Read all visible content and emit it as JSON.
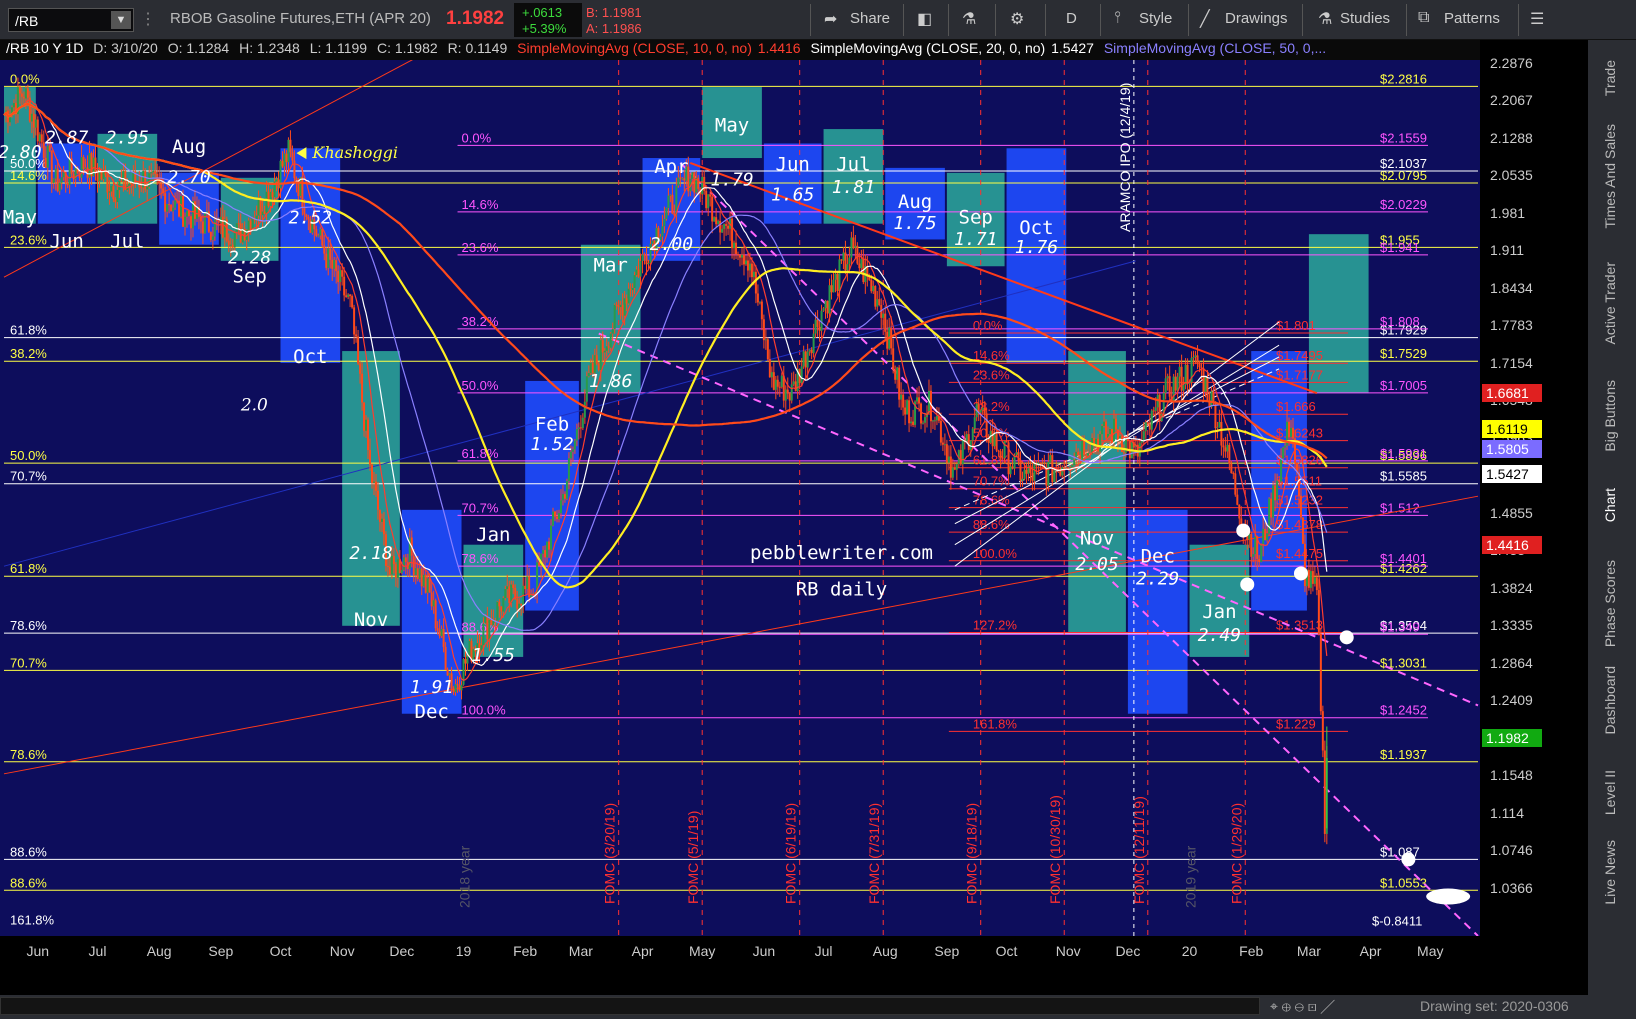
{
  "toolbar": {
    "symbol": "/RB",
    "instrument": "RBOB Gasoline Futures,ETH (APR 20)",
    "last": "1.1982",
    "change": "+.0613",
    "change_pct": "+5.39%",
    "bid": "B: 1.1981",
    "ask": "A: 1.1986",
    "share": "Share",
    "period": "D",
    "style": "Style",
    "drawings": "Drawings",
    "studies": "Studies",
    "patterns": "Patterns"
  },
  "info": {
    "series": "/RB 10 Y 1D",
    "date": "D: 3/10/20",
    "open": "O: 1.1284",
    "high": "H: 1.2348",
    "low": "L: 1.1199",
    "close": "C: 1.1982",
    "range": "R: 0.1149",
    "sma10": "SimpleMovingAvg (CLOSE, 10, 0, no)",
    "sma10_val": "1.4416",
    "sma20": "SimpleMovingAvg (CLOSE, 20, 0, no)",
    "sma20_val": "1.5427",
    "sma50": "SimpleMovingAvg (CLOSE, 50, 0,..."
  },
  "right_tabs": [
    "Trade",
    "Times And Sales",
    "Active Trader",
    "Big Buttons",
    "Chart",
    "Phase Scores",
    "Dashboard",
    "Level II",
    "Live News"
  ],
  "drawing_set": "Drawing set: 2020-0306",
  "colors": {
    "bg": "#0d0d5c",
    "candle": "#ff4a1a",
    "sma10": "#ff3d2e",
    "sma20": "#ffffff",
    "sma50": "#8a80ff",
    "sma200": "#ff3a1a",
    "fib_yellow": "#ffff44",
    "fib_magenta": "#ff55ff",
    "fomc": "#ff3030",
    "teal": "#2aa198",
    "blue": "#1f4cff"
  },
  "chart_data": {
    "type": "candlestick",
    "title": "pebblewriter.com RB daily",
    "x_range": [
      "2018-05-15",
      "2020-05-25"
    ],
    "y_range": [
      1.01,
      2.34
    ],
    "x_ticks": [
      {
        "d": "2018-06-01",
        "label": "Jun"
      },
      {
        "d": "2018-07-01",
        "label": "Jul"
      },
      {
        "d": "2018-08-01",
        "label": "Aug"
      },
      {
        "d": "2018-09-01",
        "label": "Sep"
      },
      {
        "d": "2018-10-01",
        "label": "Oct"
      },
      {
        "d": "2018-11-01",
        "label": "Nov"
      },
      {
        "d": "2018-12-01",
        "label": "Dec"
      },
      {
        "d": "2019-01-01",
        "label": "19"
      },
      {
        "d": "2019-02-01",
        "label": "Feb"
      },
      {
        "d": "2019-03-01",
        "label": "Mar"
      },
      {
        "d": "2019-04-01",
        "label": "Apr"
      },
      {
        "d": "2019-05-01",
        "label": "May"
      },
      {
        "d": "2019-06-01",
        "label": "Jun"
      },
      {
        "d": "2019-07-01",
        "label": "Jul"
      },
      {
        "d": "2019-08-01",
        "label": "Aug"
      },
      {
        "d": "2019-09-01",
        "label": "Sep"
      },
      {
        "d": "2019-10-01",
        "label": "Oct"
      },
      {
        "d": "2019-11-01",
        "label": "Nov"
      },
      {
        "d": "2019-12-01",
        "label": "Dec"
      },
      {
        "d": "2020-01-01",
        "label": "20"
      },
      {
        "d": "2020-02-01",
        "label": "Feb"
      },
      {
        "d": "2020-03-01",
        "label": "Mar"
      },
      {
        "d": "2020-04-01",
        "label": "Apr"
      },
      {
        "d": "2020-05-01",
        "label": "May"
      }
    ],
    "y_ticks": [
      "2.2876",
      "2.2067",
      "2.1288",
      "2.0535",
      "1.981",
      "1.911",
      "1.8434",
      "1.7783",
      "1.7154",
      "1.6548",
      "1.5963",
      "1.5399",
      "1.4855",
      "1.433",
      "1.3824",
      "1.3335",
      "1.2864",
      "1.2409",
      "1.1971",
      "1.1548",
      "1.114",
      "1.0746",
      "1.0366"
    ],
    "price_tags": [
      {
        "v": 1.6681,
        "label": "1.6681",
        "bg": "#e02020",
        "fg": "#ffffff"
      },
      {
        "v": 1.6119,
        "label": "1.6119",
        "bg": "#ffff00",
        "fg": "#000000"
      },
      {
        "v": 1.5805,
        "label": "1.5805",
        "bg": "#7b6cff",
        "fg": "#ffffff"
      },
      {
        "v": 1.5427,
        "label": "1.5427",
        "bg": "#ffffff",
        "fg": "#000000"
      },
      {
        "v": 1.4416,
        "label": "1.4416",
        "bg": "#e02020",
        "fg": "#ffffff"
      },
      {
        "v": 1.1982,
        "label": "1.1982",
        "bg": "#11aa11",
        "fg": "#ffffff"
      }
    ],
    "ohlc_anchors": [
      [
        "2018-05-15",
        2.22
      ],
      [
        "2018-05-25",
        2.27
      ],
      [
        "2018-06-10",
        2.08
      ],
      [
        "2018-06-25",
        2.12
      ],
      [
        "2018-07-10",
        2.07
      ],
      [
        "2018-07-25",
        2.09
      ],
      [
        "2018-08-10",
        2.03
      ],
      [
        "2018-08-25",
        2.0
      ],
      [
        "2018-09-10",
        1.98
      ],
      [
        "2018-09-25",
        2.06
      ],
      [
        "2018-10-05",
        2.14
      ],
      [
        "2018-10-15",
        2.02
      ],
      [
        "2018-10-25",
        1.93
      ],
      [
        "2018-11-05",
        1.85
      ],
      [
        "2018-11-15",
        1.58
      ],
      [
        "2018-11-25",
        1.43
      ],
      [
        "2018-12-05",
        1.46
      ],
      [
        "2018-12-15",
        1.4
      ],
      [
        "2018-12-27",
        1.28
      ],
      [
        "2019-01-05",
        1.33
      ],
      [
        "2019-01-20",
        1.39
      ],
      [
        "2019-02-05",
        1.41
      ],
      [
        "2019-02-20",
        1.54
      ],
      [
        "2019-03-05",
        1.72
      ],
      [
        "2019-03-25",
        1.88
      ],
      [
        "2019-04-10",
        2.0
      ],
      [
        "2019-04-25",
        2.1
      ],
      [
        "2019-05-10",
        2.01
      ],
      [
        "2019-05-25",
        1.93
      ],
      [
        "2019-06-05",
        1.72
      ],
      [
        "2019-06-15",
        1.7
      ],
      [
        "2019-06-30",
        1.84
      ],
      [
        "2019-07-15",
        1.95
      ],
      [
        "2019-07-30",
        1.85
      ],
      [
        "2019-08-10",
        1.67
      ],
      [
        "2019-08-25",
        1.68
      ],
      [
        "2019-09-05",
        1.57
      ],
      [
        "2019-09-16",
        1.67
      ],
      [
        "2019-09-25",
        1.62
      ],
      [
        "2019-10-10",
        1.57
      ],
      [
        "2019-10-25",
        1.58
      ],
      [
        "2019-11-10",
        1.62
      ],
      [
        "2019-11-25",
        1.64
      ],
      [
        "2019-12-05",
        1.6
      ],
      [
        "2019-12-20",
        1.7
      ],
      [
        "2020-01-05",
        1.75
      ],
      [
        "2020-01-15",
        1.66
      ],
      [
        "2020-01-28",
        1.5
      ],
      [
        "2020-02-05",
        1.45
      ],
      [
        "2020-02-15",
        1.58
      ],
      [
        "2020-02-21",
        1.66
      ],
      [
        "2020-02-28",
        1.43
      ],
      [
        "2020-03-05",
        1.4
      ],
      [
        "2020-03-09",
        1.13
      ],
      [
        "2020-03-10",
        1.198
      ]
    ],
    "last_bar": {
      "date": "2020-03-10",
      "open": 1.1284,
      "high": 1.2348,
      "low": 1.1199,
      "close": 1.1982
    },
    "moving_averages": [
      {
        "name": "SimpleMovingAvg (CLOSE, 10, 0, no)",
        "color": "#ff3d2e",
        "window": 10
      },
      {
        "name": "SimpleMovingAvg (CLOSE, 20, 0, no)",
        "color": "#ffffff",
        "window": 20
      },
      {
        "name": "SimpleMovingAvg (CLOSE, 50, 0,...",
        "color": "#8a80ff",
        "window": 50
      },
      {
        "name": "",
        "color": "#ffee22",
        "window": 100
      },
      {
        "name": "",
        "color": "#ff4a1a",
        "window": 200
      }
    ],
    "month_boxes": [
      {
        "s": "2018-05-15",
        "e": "2018-05-31",
        "lo": 2.0,
        "hi": 2.28,
        "c": "teal",
        "label": "May",
        "price": "2.80",
        "lab_y": 2.0,
        "pr_y": 2.13
      },
      {
        "s": "2018-06-01",
        "e": "2018-06-30",
        "lo": 2.0,
        "hi": 2.16,
        "c": "blue",
        "label": "Jun",
        "price": "2.87",
        "lab_y": 1.955,
        "pr_y": 2.16
      },
      {
        "s": "2018-07-01",
        "e": "2018-07-31",
        "lo": 2.0,
        "hi": 2.18,
        "c": "teal",
        "label": "Jul",
        "price": "2.95",
        "lab_y": 1.955,
        "pr_y": 2.16
      },
      {
        "s": "2018-08-01",
        "e": "2018-08-31",
        "lo": 1.96,
        "hi": 2.1,
        "c": "blue",
        "label": "Aug",
        "price": "2.70",
        "lab_y": 2.14,
        "pr_y": 2.08
      },
      {
        "s": "2018-09-01",
        "e": "2018-09-30",
        "lo": 1.93,
        "hi": 2.09,
        "c": "teal",
        "label": "Sep",
        "price": "2.28",
        "lab_y": 1.89,
        "pr_y": 1.925
      },
      {
        "s": "2018-10-01",
        "e": "2018-10-31",
        "lo": 1.75,
        "hi": 2.15,
        "c": "blue",
        "label": "Oct",
        "price": "2.52",
        "lab_y": 1.75,
        "pr_y": 2.0
      },
      {
        "s": "2018-11-01",
        "e": "2018-11-30",
        "lo": 1.36,
        "hi": 1.77,
        "c": "teal",
        "label": "Nov",
        "price": "2.18",
        "lab_y": 1.36,
        "pr_y": 1.45
      },
      {
        "s": "2018-12-01",
        "e": "2018-12-31",
        "lo": 1.25,
        "hi": 1.52,
        "c": "blue",
        "label": "Dec",
        "price": "1.91",
        "lab_y": 1.245,
        "pr_y": 1.275
      },
      {
        "s": "2019-01-01",
        "e": "2019-01-31",
        "lo": 1.32,
        "hi": 1.47,
        "c": "teal",
        "label": "Jan",
        "price": "1.55",
        "lab_y": 1.475,
        "pr_y": 1.315
      },
      {
        "s": "2019-02-01",
        "e": "2019-02-28",
        "lo": 1.38,
        "hi": 1.72,
        "c": "blue",
        "label": "Feb",
        "price": "1.52",
        "lab_y": 1.64,
        "pr_y": 1.61
      },
      {
        "s": "2019-03-01",
        "e": "2019-03-31",
        "lo": 1.7,
        "hi": 1.96,
        "c": "teal",
        "label": "Mar",
        "price": "1.86",
        "lab_y": 1.91,
        "pr_y": 1.71
      },
      {
        "s": "2019-04-01",
        "e": "2019-04-30",
        "lo": 1.93,
        "hi": 2.13,
        "c": "blue",
        "label": "Apr",
        "price": "2.00",
        "lab_y": 2.1,
        "pr_y": 1.95
      },
      {
        "s": "2019-05-01",
        "e": "2019-05-31",
        "lo": 2.13,
        "hi": 2.28,
        "c": "teal",
        "label": "May",
        "price": "1.79",
        "lab_y": 2.185,
        "pr_y": 2.075
      },
      {
        "s": "2019-06-01",
        "e": "2019-06-30",
        "lo": 2.0,
        "hi": 2.16,
        "c": "blue",
        "label": "Jun",
        "price": "1.65",
        "lab_y": 2.105,
        "pr_y": 2.045
      },
      {
        "s": "2019-07-01",
        "e": "2019-07-31",
        "lo": 2.0,
        "hi": 2.19,
        "c": "teal",
        "label": "Jul",
        "price": "1.81",
        "lab_y": 2.105,
        "pr_y": 2.06
      },
      {
        "s": "2019-08-01",
        "e": "2019-08-31",
        "lo": 1.97,
        "hi": 2.11,
        "c": "blue",
        "label": "Aug",
        "price": "1.75",
        "lab_y": 2.03,
        "pr_y": 1.99
      },
      {
        "s": "2019-09-01",
        "e": "2019-09-30",
        "lo": 1.92,
        "hi": 2.1,
        "c": "teal",
        "label": "Sep",
        "price": "1.71",
        "lab_y": 2.0,
        "pr_y": 1.96
      },
      {
        "s": "2019-10-01",
        "e": "2019-10-31",
        "lo": 1.75,
        "hi": 2.15,
        "c": "blue",
        "label": "Oct",
        "price": "1.76",
        "lab_y": 1.98,
        "pr_y": 1.945
      },
      {
        "s": "2019-11-01",
        "e": "2019-11-30",
        "lo": 1.35,
        "hi": 1.77,
        "c": "teal",
        "label": "Nov",
        "price": "2.05",
        "lab_y": 1.47,
        "pr_y": 1.435
      },
      {
        "s": "2019-12-01",
        "e": "2019-12-31",
        "lo": 1.25,
        "hi": 1.52,
        "c": "blue",
        "label": "Dec",
        "price": "2.29",
        "lab_y": 1.445,
        "pr_y": 1.415
      },
      {
        "s": "2020-01-01",
        "e": "2020-01-31",
        "lo": 1.32,
        "hi": 1.47,
        "c": "teal",
        "label": "Jan",
        "price": "2.49",
        "lab_y": 1.37,
        "pr_y": 1.34
      },
      {
        "s": "2020-02-01",
        "e": "2020-02-29",
        "lo": 1.38,
        "hi": 1.77,
        "c": "blue",
        "label": "",
        "price": "",
        "lab_y": 0,
        "pr_y": 0
      },
      {
        "s": "2020-03-01",
        "e": "2020-03-31",
        "lo": 1.7,
        "hi": 1.98,
        "c": "teal",
        "label": "",
        "price": "",
        "lab_y": 0,
        "pr_y": 0
      }
    ],
    "fib_lines_left": [
      {
        "v": 2.2816,
        "label": "0.0%",
        "price": "$2.2816"
      },
      {
        "v": 2.0795,
        "label": "14.6%",
        "price": "$2.0795"
      },
      {
        "v": 2.1037,
        "label": "50.0%",
        "price": "$2.1037",
        "c": "#ffffff"
      },
      {
        "v": 1.955,
        "label": "23.6%",
        "price": "$1.955"
      },
      {
        "v": 1.7929,
        "label": "61.8%",
        "price": "$1.7929",
        "c": "#ffffff"
      },
      {
        "v": 1.7529,
        "label": "38.2%",
        "price": "$1.7529"
      },
      {
        "v": 1.5896,
        "label": "50.0%",
        "price": "$1.5896"
      },
      {
        "v": 1.5585,
        "label": "70.7%",
        "price": "$1.5585",
        "c": "#ffffff"
      },
      {
        "v": 1.4262,
        "label": "61.8%",
        "price": "$1.4262"
      },
      {
        "v": 1.3504,
        "label": "78.6%",
        "price": "$1.3504",
        "c": "#ffffff"
      },
      {
        "v": 1.3031,
        "label": "70.7%",
        "price": "$1.3031"
      },
      {
        "v": 1.1937,
        "label": "78.6%",
        "price": "$1.1937"
      },
      {
        "v": 1.087,
        "label": "88.6%",
        "price": "$1.087",
        "c": "#ffffff"
      },
      {
        "v": 1.0553,
        "label": "88.6%",
        "price": "$1.0553"
      }
    ],
    "fib_extra_left": [
      {
        "v": 1.025,
        "label": "161.8%"
      }
    ],
    "fib_extra_price": [
      {
        "v": 1.0243,
        "label": "$-0.8411"
      }
    ],
    "fib_lines_mid": [
      {
        "v": 2.1559,
        "label": "0.0%",
        "price": "$2.1559"
      },
      {
        "v": 2.0229,
        "label": "14.6%",
        "price": "$2.0229"
      },
      {
        "v": 1.941,
        "label": "23.6%",
        "price": "$1.941"
      },
      {
        "v": 1.808,
        "label": "38.2%",
        "price": "$1.808"
      },
      {
        "v": 1.7005,
        "label": "50.0%",
        "price": "$1.7005"
      },
      {
        "v": 1.5931,
        "label": "61.8%",
        "price": "$1.5931"
      },
      {
        "v": 1.512,
        "label": "70.7%",
        "price": "$1.512"
      },
      {
        "v": 1.4401,
        "label": "78.6%",
        "price": "$1.4401"
      },
      {
        "v": 1.349,
        "label": "88.6%",
        "price": "$1.349"
      },
      {
        "v": 1.2452,
        "label": "100.0%",
        "price": "$1.2452"
      }
    ],
    "fib_lines_right": [
      {
        "v": 1.801,
        "label": "0.0%",
        "price": "$1.801"
      },
      {
        "v": 1.7495,
        "label": "14.6%",
        "price": "$1.7495"
      },
      {
        "v": 1.7177,
        "label": "23.6%",
        "price": "$1.7177"
      },
      {
        "v": 1.666,
        "label": "38.2%",
        "price": "$1.666"
      },
      {
        "v": 1.6243,
        "label": "50.0%",
        "price": "$1.6243"
      },
      {
        "v": 1.5826,
        "label": "61.8%",
        "price": "$1.5826"
      },
      {
        "v": 1.5511,
        "label": "70.7%",
        "price": "$1.5511"
      },
      {
        "v": 1.5232,
        "label": "78.6%",
        "price": "$1.5232"
      },
      {
        "v": 1.4878,
        "label": "88.6%",
        "price": "$1.4878"
      },
      {
        "v": 1.4475,
        "label": "100.0%",
        "price": "$1.4475"
      },
      {
        "v": 1.3513,
        "label": "127.2%",
        "price": "$1.3513"
      },
      {
        "v": 1.229,
        "label": "161.8%",
        "price": "$1.229"
      }
    ],
    "fomc": [
      "FOMC (3/20/19)",
      "FOMC (5/1/19)",
      "FOMC (6/19/19)",
      "FOMC (7/31/19)",
      "FOMC (9/18/19)",
      "FOMC (10/30/19)",
      "FOMC (12/11/19)",
      "FOMC (1/29/20)"
    ],
    "fomc_dates": [
      "2019-03-20",
      "2019-05-01",
      "2019-06-19",
      "2019-07-31",
      "2019-09-18",
      "2019-10-30",
      "2019-12-11",
      "2020-01-29"
    ],
    "event": {
      "d": "2019-12-04",
      "label": "ARAMCO IPO (12/4/19)"
    },
    "year_marks": [
      {
        "d": "2018-12-31",
        "label": "2018 year"
      },
      {
        "d": "2019-12-31",
        "label": "2019 year"
      }
    ],
    "annotations": [
      {
        "d": "2018-10-07",
        "v": 2.14,
        "label": "Khashoggi"
      },
      {
        "d": "2018-09-01",
        "v": 1.68,
        "label": "2.0"
      }
    ],
    "watermark": [
      "pebblewriter.com",
      "RB daily"
    ]
  }
}
